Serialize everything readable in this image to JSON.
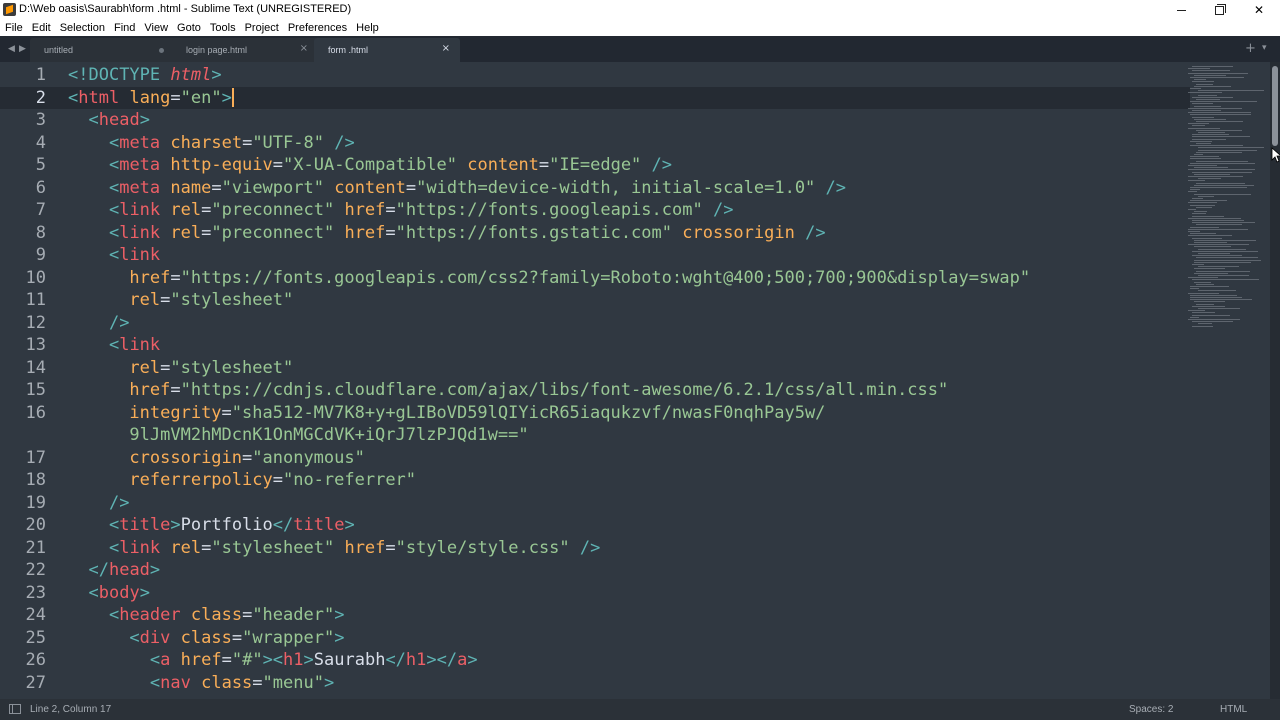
{
  "window": {
    "title": "D:\\Web oasis\\Saurabh\\form .html - Sublime Text (UNREGISTERED)"
  },
  "menu": [
    "File",
    "Edit",
    "Selection",
    "Find",
    "View",
    "Goto",
    "Tools",
    "Project",
    "Preferences",
    "Help"
  ],
  "tabs": [
    {
      "label": "untitled",
      "state": "modified"
    },
    {
      "label": "login page.html",
      "state": "close"
    },
    {
      "label": "form .html",
      "state": "active"
    }
  ],
  "editor": {
    "current_line": 2,
    "lines": [
      {
        "n": "1",
        "tokens": [
          [
            "punc",
            "<!"
          ],
          [
            "doc",
            "DOCTYPE"
          ],
          [
            "text",
            " "
          ],
          [
            "dockw",
            "html"
          ],
          [
            "punc",
            ">"
          ]
        ]
      },
      {
        "n": "2",
        "tokens": [
          [
            "punc",
            "<"
          ],
          [
            "tag",
            "html"
          ],
          [
            "text",
            " "
          ],
          [
            "attr",
            "lang"
          ],
          [
            "text",
            "="
          ],
          [
            "str",
            "\"en\""
          ],
          [
            "punc",
            ">"
          ]
        ],
        "caret": true
      },
      {
        "n": "3",
        "tokens": [
          [
            "text",
            "  "
          ],
          [
            "punc",
            "<"
          ],
          [
            "tag",
            "head"
          ],
          [
            "punc",
            ">"
          ]
        ]
      },
      {
        "n": "4",
        "tokens": [
          [
            "text",
            "    "
          ],
          [
            "punc",
            "<"
          ],
          [
            "tag",
            "meta"
          ],
          [
            "text",
            " "
          ],
          [
            "attr",
            "charset"
          ],
          [
            "text",
            "="
          ],
          [
            "str",
            "\"UTF-8\""
          ],
          [
            "text",
            " "
          ],
          [
            "punc",
            "/>"
          ]
        ]
      },
      {
        "n": "5",
        "tokens": [
          [
            "text",
            "    "
          ],
          [
            "punc",
            "<"
          ],
          [
            "tag",
            "meta"
          ],
          [
            "text",
            " "
          ],
          [
            "attr",
            "http-equiv"
          ],
          [
            "text",
            "="
          ],
          [
            "str",
            "\"X-UA-Compatible\""
          ],
          [
            "text",
            " "
          ],
          [
            "attr",
            "content"
          ],
          [
            "text",
            "="
          ],
          [
            "str",
            "\"IE=edge\""
          ],
          [
            "text",
            " "
          ],
          [
            "punc",
            "/>"
          ]
        ]
      },
      {
        "n": "6",
        "tokens": [
          [
            "text",
            "    "
          ],
          [
            "punc",
            "<"
          ],
          [
            "tag",
            "meta"
          ],
          [
            "text",
            " "
          ],
          [
            "attr",
            "name"
          ],
          [
            "text",
            "="
          ],
          [
            "str",
            "\"viewport\""
          ],
          [
            "text",
            " "
          ],
          [
            "attr",
            "content"
          ],
          [
            "text",
            "="
          ],
          [
            "str",
            "\"width=device-width, initial-scale=1.0\""
          ],
          [
            "text",
            " "
          ],
          [
            "punc",
            "/>"
          ]
        ]
      },
      {
        "n": "7",
        "tokens": [
          [
            "text",
            "    "
          ],
          [
            "punc",
            "<"
          ],
          [
            "tag",
            "link"
          ],
          [
            "text",
            " "
          ],
          [
            "attr",
            "rel"
          ],
          [
            "text",
            "="
          ],
          [
            "str",
            "\"preconnect\""
          ],
          [
            "text",
            " "
          ],
          [
            "attr",
            "href"
          ],
          [
            "text",
            "="
          ],
          [
            "str",
            "\"https://fonts.googleapis.com\""
          ],
          [
            "text",
            " "
          ],
          [
            "punc",
            "/>"
          ]
        ]
      },
      {
        "n": "8",
        "tokens": [
          [
            "text",
            "    "
          ],
          [
            "punc",
            "<"
          ],
          [
            "tag",
            "link"
          ],
          [
            "text",
            " "
          ],
          [
            "attr",
            "rel"
          ],
          [
            "text",
            "="
          ],
          [
            "str",
            "\"preconnect\""
          ],
          [
            "text",
            " "
          ],
          [
            "attr",
            "href"
          ],
          [
            "text",
            "="
          ],
          [
            "str",
            "\"https://fonts.gstatic.com\""
          ],
          [
            "text",
            " "
          ],
          [
            "attr",
            "crossorigin"
          ],
          [
            "text",
            " "
          ],
          [
            "punc",
            "/>"
          ]
        ]
      },
      {
        "n": "9",
        "tokens": [
          [
            "text",
            "    "
          ],
          [
            "punc",
            "<"
          ],
          [
            "tag",
            "link"
          ]
        ]
      },
      {
        "n": "10",
        "tokens": [
          [
            "text",
            "      "
          ],
          [
            "attr",
            "href"
          ],
          [
            "text",
            "="
          ],
          [
            "str",
            "\"https://fonts.googleapis.com/css2?family=Roboto:wght@400;500;700;900&display=swap\""
          ]
        ]
      },
      {
        "n": "11",
        "tokens": [
          [
            "text",
            "      "
          ],
          [
            "attr",
            "rel"
          ],
          [
            "text",
            "="
          ],
          [
            "str",
            "\"stylesheet\""
          ]
        ]
      },
      {
        "n": "12",
        "tokens": [
          [
            "text",
            "    "
          ],
          [
            "punc",
            "/>"
          ]
        ]
      },
      {
        "n": "13",
        "tokens": [
          [
            "text",
            "    "
          ],
          [
            "punc",
            "<"
          ],
          [
            "tag",
            "link"
          ]
        ]
      },
      {
        "n": "14",
        "tokens": [
          [
            "text",
            "      "
          ],
          [
            "attr",
            "rel"
          ],
          [
            "text",
            "="
          ],
          [
            "str",
            "\"stylesheet\""
          ]
        ]
      },
      {
        "n": "15",
        "tokens": [
          [
            "text",
            "      "
          ],
          [
            "attr",
            "href"
          ],
          [
            "text",
            "="
          ],
          [
            "str",
            "\"https://cdnjs.cloudflare.com/ajax/libs/font-awesome/6.2.1/css/all.min.css\""
          ]
        ]
      },
      {
        "n": "16",
        "tokens": [
          [
            "text",
            "      "
          ],
          [
            "attr",
            "integrity"
          ],
          [
            "text",
            "="
          ],
          [
            "str",
            "\"sha512-MV7K8+y+gLIBoVD59lQIYicR65iaqukzvf/nwasF0nqhPay5w/"
          ]
        ]
      },
      {
        "n": "",
        "tokens": [
          [
            "text",
            "      "
          ],
          [
            "str",
            "9lJmVM2hMDcnK1OnMGCdVK+iQrJ7lzPJQd1w==\""
          ]
        ]
      },
      {
        "n": "17",
        "tokens": [
          [
            "text",
            "      "
          ],
          [
            "attr",
            "crossorigin"
          ],
          [
            "text",
            "="
          ],
          [
            "str",
            "\"anonymous\""
          ]
        ]
      },
      {
        "n": "18",
        "tokens": [
          [
            "text",
            "      "
          ],
          [
            "attr",
            "referrerpolicy"
          ],
          [
            "text",
            "="
          ],
          [
            "str",
            "\"no-referrer\""
          ]
        ]
      },
      {
        "n": "19",
        "tokens": [
          [
            "text",
            "    "
          ],
          [
            "punc",
            "/>"
          ]
        ]
      },
      {
        "n": "20",
        "tokens": [
          [
            "text",
            "    "
          ],
          [
            "punc",
            "<"
          ],
          [
            "tag",
            "title"
          ],
          [
            "punc",
            ">"
          ],
          [
            "text",
            "Portfolio"
          ],
          [
            "punc",
            "</"
          ],
          [
            "tag",
            "title"
          ],
          [
            "punc",
            ">"
          ]
        ]
      },
      {
        "n": "21",
        "tokens": [
          [
            "text",
            "    "
          ],
          [
            "punc",
            "<"
          ],
          [
            "tag",
            "link"
          ],
          [
            "text",
            " "
          ],
          [
            "attr",
            "rel"
          ],
          [
            "text",
            "="
          ],
          [
            "str",
            "\"stylesheet\""
          ],
          [
            "text",
            " "
          ],
          [
            "attr",
            "href"
          ],
          [
            "text",
            "="
          ],
          [
            "str",
            "\"style/style.css\""
          ],
          [
            "text",
            " "
          ],
          [
            "punc",
            "/>"
          ]
        ]
      },
      {
        "n": "22",
        "tokens": [
          [
            "text",
            "  "
          ],
          [
            "punc",
            "</"
          ],
          [
            "tag",
            "head"
          ],
          [
            "punc",
            ">"
          ]
        ]
      },
      {
        "n": "23",
        "tokens": [
          [
            "text",
            "  "
          ],
          [
            "punc",
            "<"
          ],
          [
            "tag",
            "body"
          ],
          [
            "punc",
            ">"
          ]
        ]
      },
      {
        "n": "24",
        "tokens": [
          [
            "text",
            "    "
          ],
          [
            "punc",
            "<"
          ],
          [
            "tag",
            "header"
          ],
          [
            "text",
            " "
          ],
          [
            "attr",
            "class"
          ],
          [
            "text",
            "="
          ],
          [
            "str",
            "\"header\""
          ],
          [
            "punc",
            ">"
          ]
        ]
      },
      {
        "n": "25",
        "tokens": [
          [
            "text",
            "      "
          ],
          [
            "punc",
            "<"
          ],
          [
            "tag",
            "div"
          ],
          [
            "text",
            " "
          ],
          [
            "attr",
            "class"
          ],
          [
            "text",
            "="
          ],
          [
            "str",
            "\"wrapper\""
          ],
          [
            "punc",
            ">"
          ]
        ]
      },
      {
        "n": "26",
        "tokens": [
          [
            "text",
            "        "
          ],
          [
            "punc",
            "<"
          ],
          [
            "tag",
            "a"
          ],
          [
            "text",
            " "
          ],
          [
            "attr",
            "href"
          ],
          [
            "text",
            "="
          ],
          [
            "str",
            "\"#\""
          ],
          [
            "punc",
            "><"
          ],
          [
            "tag",
            "h1"
          ],
          [
            "punc",
            ">"
          ],
          [
            "text",
            "Saurabh"
          ],
          [
            "punc",
            "</"
          ],
          [
            "tag",
            "h1"
          ],
          [
            "punc",
            "></"
          ],
          [
            "tag",
            "a"
          ],
          [
            "punc",
            ">"
          ]
        ]
      },
      {
        "n": "27",
        "tokens": [
          [
            "text",
            "        "
          ],
          [
            "punc",
            "<"
          ],
          [
            "tag",
            "nav"
          ],
          [
            "text",
            " "
          ],
          [
            "attr",
            "class"
          ],
          [
            "text",
            "="
          ],
          [
            "str",
            "\"menu\""
          ],
          [
            "punc",
            ">"
          ]
        ]
      }
    ]
  },
  "status": {
    "position": "Line 2, Column 17",
    "spaces": "Spaces: 2",
    "syntax": "HTML"
  },
  "colors": {
    "background": "#303841",
    "tag": "#ec5f66",
    "attribute": "#f9ae58",
    "string": "#99c794",
    "punctuation": "#5fb4b4"
  }
}
